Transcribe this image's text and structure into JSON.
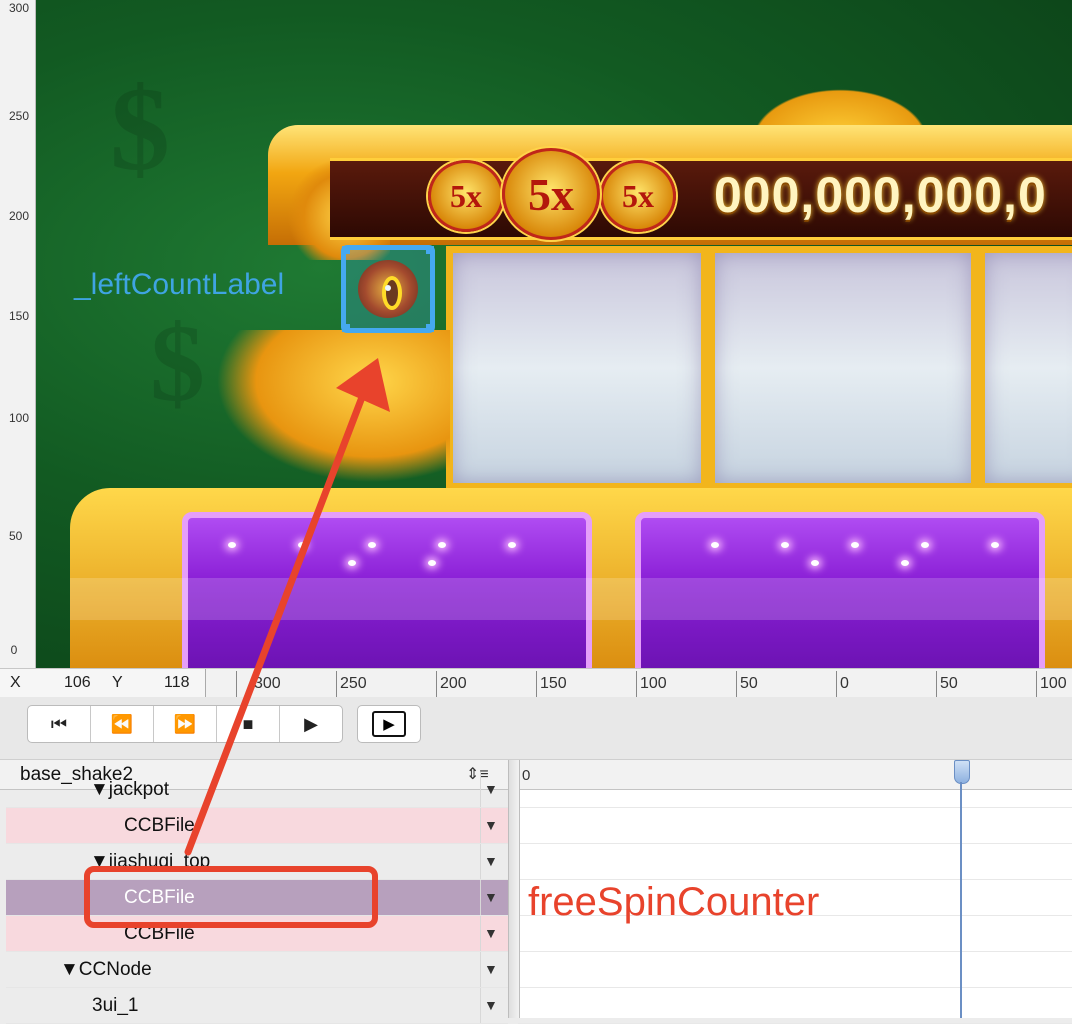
{
  "canvas": {
    "jackpot_multiplier_small": "5x",
    "jackpot_multiplier_big": "5x",
    "jackpot_amount": "000,000,000,0",
    "selected_node_label": "_leftCountLabel",
    "vertical_ruler_labels": [
      "300",
      "250",
      "200",
      "150",
      "100",
      "50",
      "0"
    ]
  },
  "ruler": {
    "x_label": "X",
    "x_value": "106",
    "y_label": "Y",
    "y_value": "118",
    "labels": [
      "300",
      "250",
      "200",
      "150",
      "100",
      "50",
      "0",
      "50",
      "100"
    ]
  },
  "toolbar": {
    "first_frame": "⏮",
    "step_back": "⏪",
    "step_forward": "⏩",
    "stop": "■",
    "play": "▶",
    "play_loop": "▶"
  },
  "timeline": {
    "sequence_name": "base_shake2",
    "sequence_menu_icon": "⇕≡",
    "ruler_start": "0",
    "rows": [
      {
        "label": "jackpot",
        "indent": 104,
        "expander": "▼",
        "style": "normal",
        "toggle": "▼"
      },
      {
        "label": "CCBFile",
        "indent": 138,
        "expander": "",
        "style": "pink",
        "toggle": "▼"
      },
      {
        "label": "jiashuqi_top",
        "indent": 104,
        "expander": "▼",
        "style": "normal",
        "toggle": "▼"
      },
      {
        "label": "CCBFile",
        "indent": 138,
        "expander": "",
        "style": "selected",
        "toggle": "▼"
      },
      {
        "label": "CCBFile",
        "indent": 138,
        "expander": "",
        "style": "pink",
        "toggle": "▼"
      },
      {
        "label": "CCNode",
        "indent": 74,
        "expander": "▼",
        "style": "normal",
        "toggle": "▼"
      },
      {
        "label": "3ui_1",
        "indent": 106,
        "expander": "",
        "style": "normal",
        "toggle": "▼"
      }
    ]
  },
  "annotations": {
    "callout_text": "freeSpinCounter",
    "color": "#e8432c"
  }
}
